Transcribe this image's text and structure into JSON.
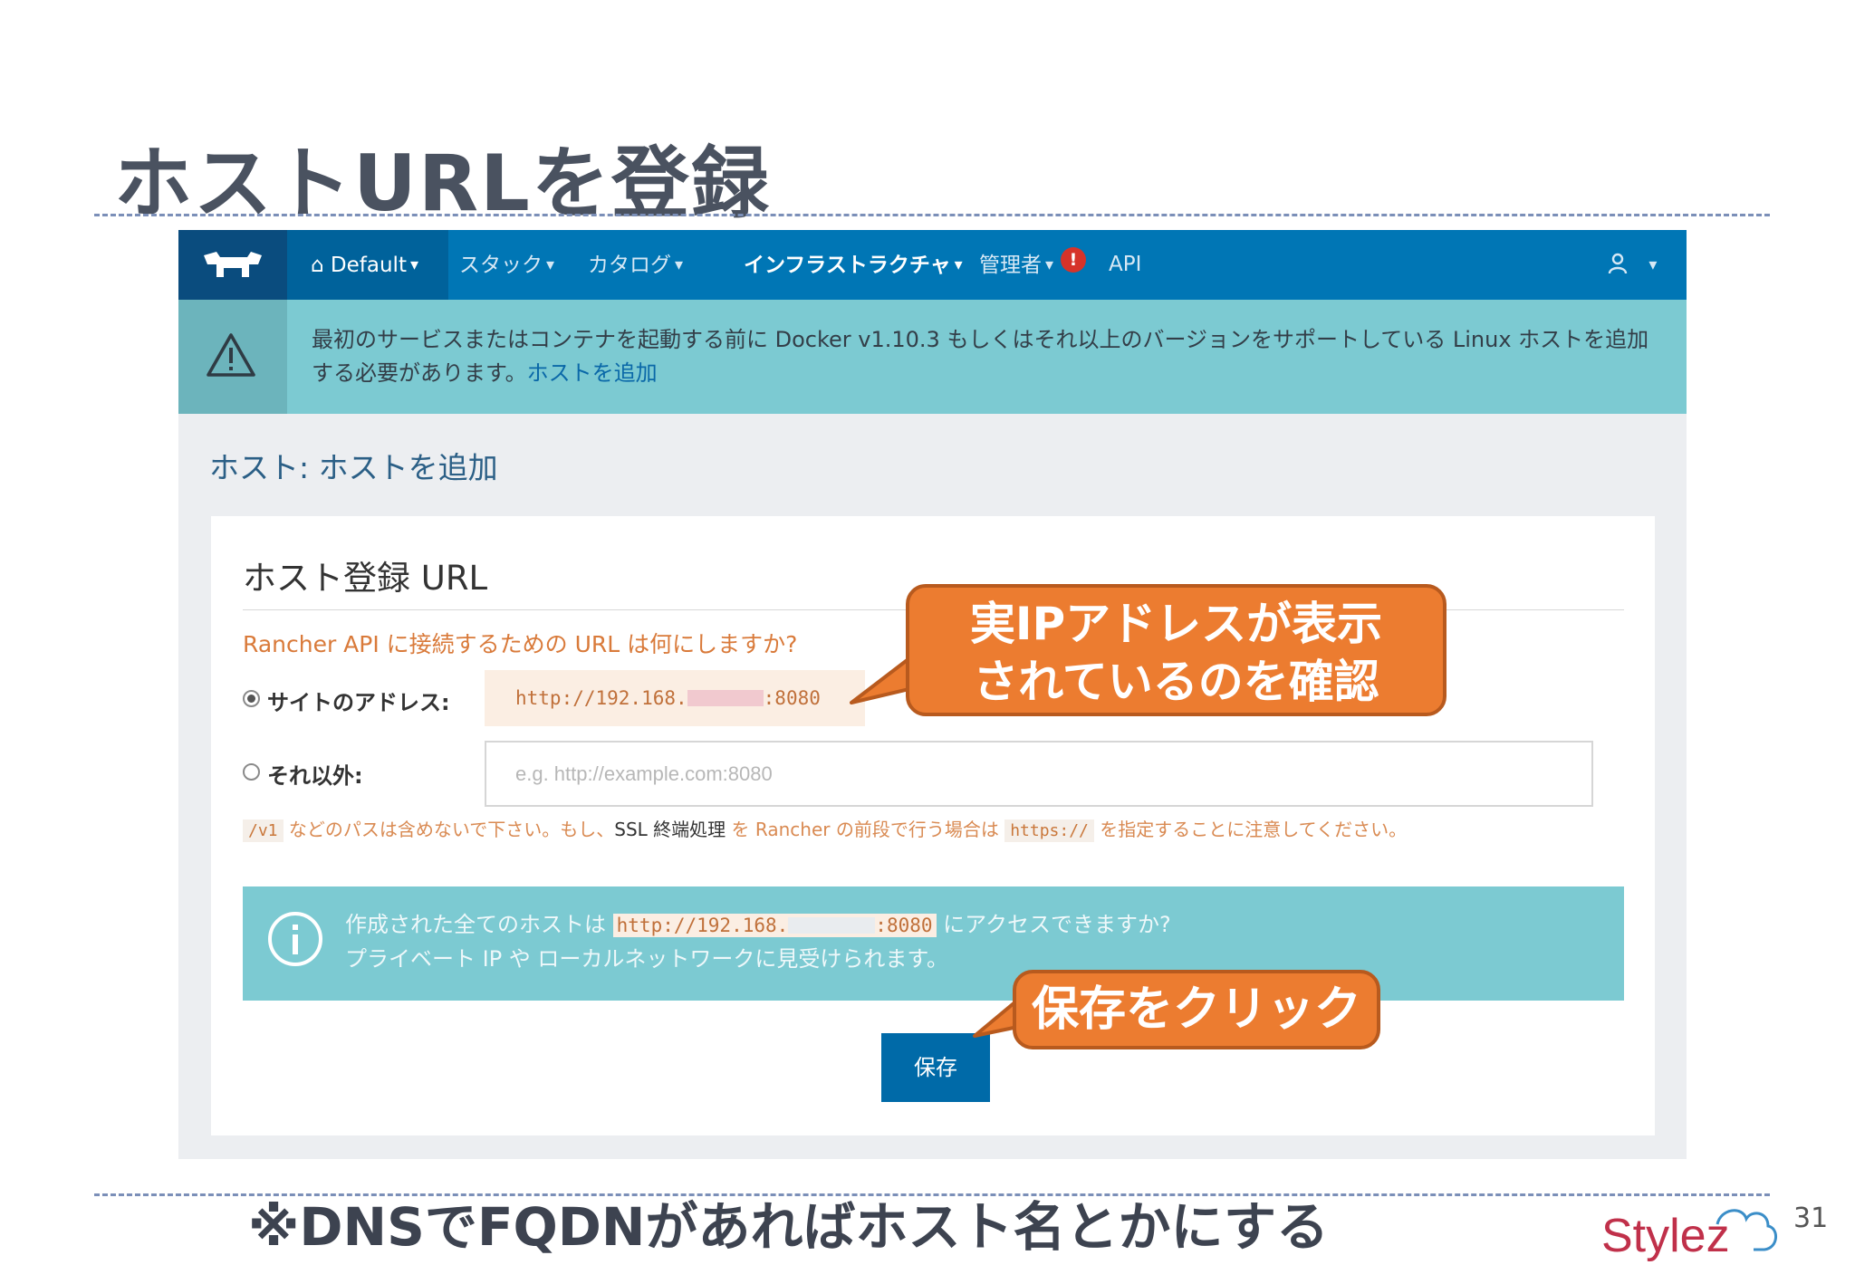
{
  "slide": {
    "title": "ホストURLを登録",
    "footnote": "※DNSでFQDNがあればホスト名とかにする",
    "page_number": "31",
    "brand": "Stylez"
  },
  "nav": {
    "env_label": "Default",
    "items": [
      "スタック",
      "カタログ",
      "インフラストラクチャ",
      "管理者",
      "API"
    ],
    "alert_badge": "!"
  },
  "notice": {
    "text": "最初のサービスまたはコンテナを起動する前に Docker v1.10.3 もしくはそれ以上のバージョンをサポートしている Linux ホストを追加する必要があります。",
    "link": "ホストを追加"
  },
  "breadcrumb": "ホスト: ホストを追加",
  "form": {
    "title": "ホスト登録 URL",
    "question": "Rancher API に接続するための URL は何にしますか?",
    "option_site_label": "サイトのアドレス:",
    "site_address_prefix": "http://192.168.",
    "site_address_suffix": ":8080",
    "option_other_label": "それ以外:",
    "other_placeholder": "e.g. http://example.com:8080",
    "hint_code1": "/v1",
    "hint_text1": " などのパスは含めないで下さい。もし、",
    "hint_ssl": "SSL 終端処理",
    "hint_text2": " を Rancher の前段で行う場合は ",
    "hint_code2": "https://",
    "hint_text3": " を指定することに注意してください。",
    "info_text1": "作成された全てのホストは ",
    "info_code_prefix": "http://192.168.",
    "info_code_suffix": ":8080",
    "info_text2": " にアクセスできますか?",
    "info_line2": "プライベート IP や ローカルネットワークに見受けられます。",
    "save_label": "保存"
  },
  "callouts": {
    "ip_line1": "実IPアドレスが表示",
    "ip_line2": "されているのを確認",
    "save_hint": "保存をクリック"
  },
  "colors": {
    "nav_bg": "#0076b5",
    "notice_bg": "#7ccad2",
    "callout_orange": "#ec7c30",
    "save_button": "#006aa8"
  }
}
